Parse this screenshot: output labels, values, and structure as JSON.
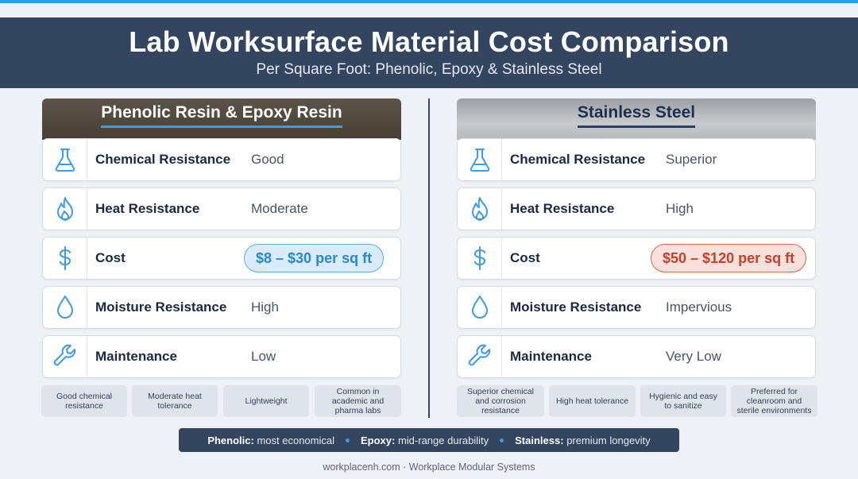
{
  "header": {
    "title": "Lab Worksurface Material Cost Comparison",
    "subtitle": "Per Square Foot: Phenolic, Epoxy & Stainless Steel"
  },
  "colors": {
    "header_bg": "#34455f",
    "accent_blue": "#2a9df4",
    "cost_low": "#2a86d6",
    "cost_high": "#c7412a"
  },
  "left": {
    "title": "Phenolic Resin & Epoxy Resin",
    "rows": [
      {
        "icon": "flask-icon",
        "label": "Chemical Resistance",
        "value": "Good"
      },
      {
        "icon": "flame-icon",
        "label": "Heat Resistance",
        "value": "Moderate"
      },
      {
        "icon": "dollar-icon",
        "label": "Cost",
        "value": "$8 – $30 per sq ft"
      },
      {
        "icon": "drop-icon",
        "label": "Moisture Resistance",
        "value": "High"
      },
      {
        "icon": "wrench-icon",
        "label": "Maintenance",
        "value": "Low"
      }
    ],
    "chips": [
      "Good chemical resistance",
      "Moderate heat tolerance",
      "Lightweight",
      "Common in academic and pharma labs"
    ]
  },
  "right": {
    "title": "Stainless Steel",
    "rows": [
      {
        "icon": "flask-icon",
        "label": "Chemical Resistance",
        "value": "Superior"
      },
      {
        "icon": "flame-icon",
        "label": "Heat Resistance",
        "value": "High"
      },
      {
        "icon": "dollar-icon",
        "label": "Cost",
        "value": "$50 – $120 per sq ft"
      },
      {
        "icon": "drop-icon",
        "label": "Moisture Resistance",
        "value": "Impervious"
      },
      {
        "icon": "wrench-icon",
        "label": "Maintenance",
        "value": "Very Low"
      }
    ],
    "chips": [
      "Superior chemical and corrosion resistance",
      "High heat tolerance",
      "Hygienic and easy to sanitize",
      "Preferred for cleanroom and sterile environments"
    ]
  },
  "legend": {
    "items": [
      {
        "key": "Phenolic:",
        "text": "most economical"
      },
      {
        "key": "Epoxy:",
        "text": "mid-range durability"
      },
      {
        "key": "Stainless:",
        "text": "premium longevity"
      }
    ]
  },
  "footer": "workplacenh.com · Workplace Modular Systems"
}
